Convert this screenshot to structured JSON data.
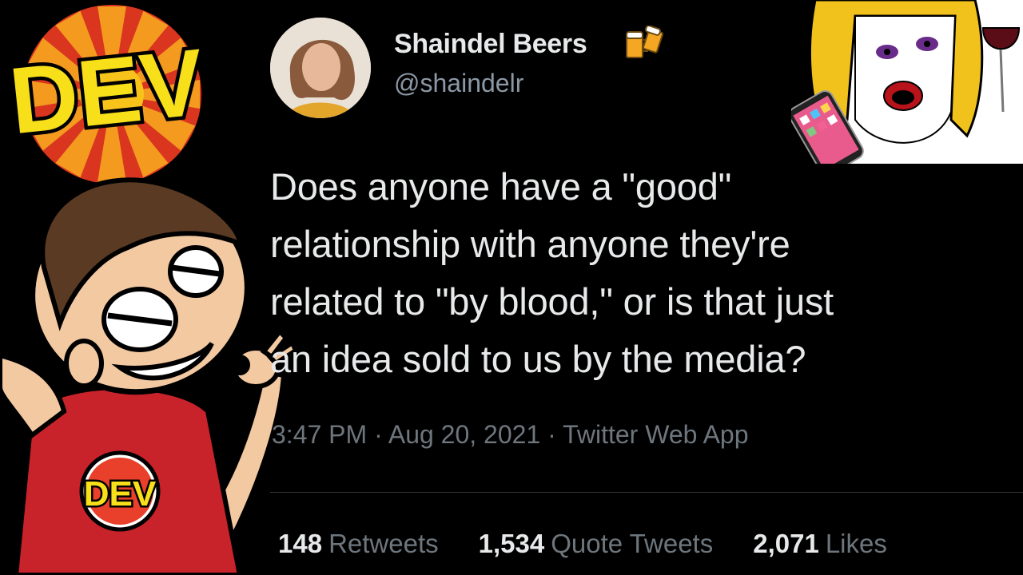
{
  "thumbnail": {
    "logo_text": "DEV",
    "shirt_logo_text": "DEV"
  },
  "tweet": {
    "display_name": "Shaindel Beers",
    "name_emoji": "beer-mugs-icon",
    "handle": "@shaindelr",
    "text_lines": [
      "Does anyone have a \"good\"",
      "relationship with anyone they're",
      "related to \"by blood,\" or is that just",
      "an idea sold to us by the media?"
    ],
    "timestamp": "3:47 PM · Aug 20, 2021 · Twitter Web App",
    "stats": [
      {
        "count": "148",
        "label": "Retweets"
      },
      {
        "count": "1,534",
        "label": "Quote Tweets"
      },
      {
        "count": "2,071",
        "label": "Likes"
      }
    ]
  },
  "colors": {
    "background": "#000000",
    "text_primary": "#e7e9ea",
    "text_secondary": "#6e767d",
    "logo_yellow": "#f7e01a",
    "logo_red": "#e8402a"
  }
}
